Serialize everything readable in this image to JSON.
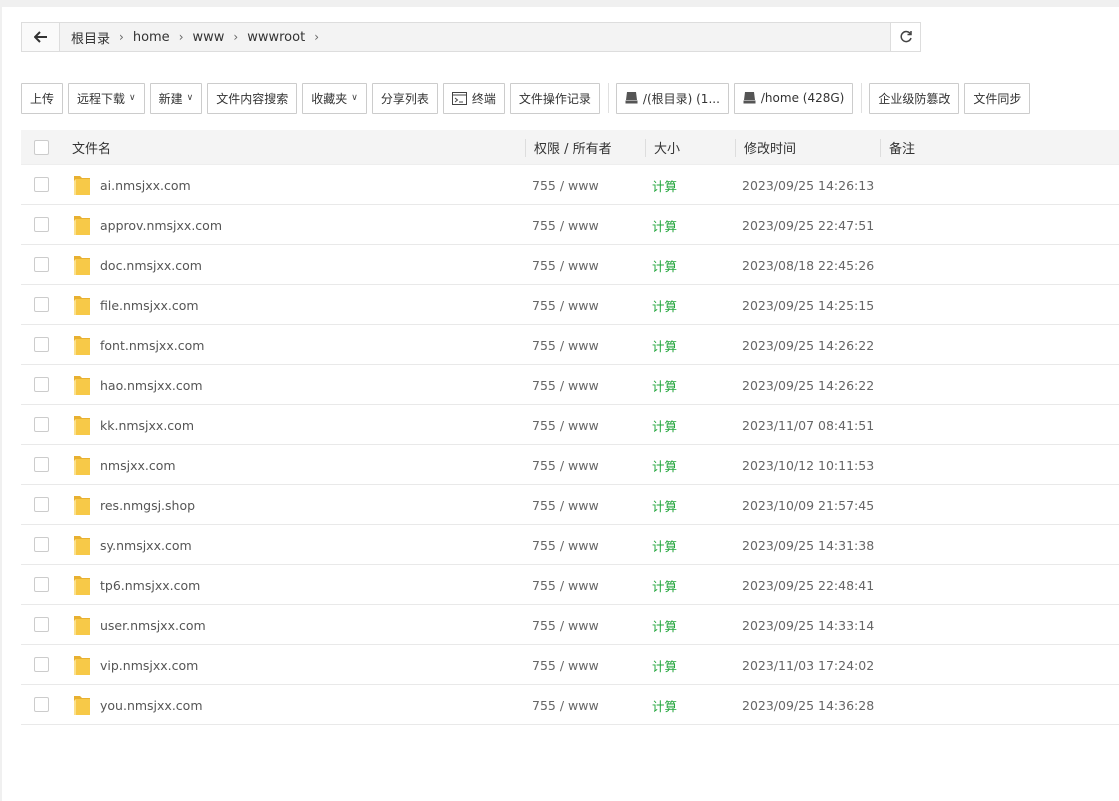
{
  "address": {
    "breadcrumbs": [
      "根目录",
      "home",
      "www",
      "wwwroot"
    ]
  },
  "toolbar": {
    "upload": "上传",
    "remote_download": "远程下载",
    "new": "新建",
    "content_search": "文件内容搜索",
    "favorites": "收藏夹",
    "share_list": "分享列表",
    "terminal": "终端",
    "operation_log": "文件操作记录",
    "disk_root": "/(根目录) (1...",
    "disk_home": "/home (428G)",
    "tamper_proof": "企业级防篡改",
    "file_sync": "文件同步"
  },
  "table": {
    "headers": {
      "name": "文件名",
      "perm": "权限 / 所有者",
      "size": "大小",
      "mtime": "修改时间",
      "note": "备注"
    },
    "rows": [
      {
        "name": "ai.nmsjxx.com",
        "perm": "755 / www",
        "size": "计算",
        "mtime": "2023/09/25 14:26:13"
      },
      {
        "name": "approv.nmsjxx.com",
        "perm": "755 / www",
        "size": "计算",
        "mtime": "2023/09/25 22:47:51"
      },
      {
        "name": "doc.nmsjxx.com",
        "perm": "755 / www",
        "size": "计算",
        "mtime": "2023/08/18 22:45:26"
      },
      {
        "name": "file.nmsjxx.com",
        "perm": "755 / www",
        "size": "计算",
        "mtime": "2023/09/25 14:25:15"
      },
      {
        "name": "font.nmsjxx.com",
        "perm": "755 / www",
        "size": "计算",
        "mtime": "2023/09/25 14:26:22"
      },
      {
        "name": "hao.nmsjxx.com",
        "perm": "755 / www",
        "size": "计算",
        "mtime": "2023/09/25 14:26:22"
      },
      {
        "name": "kk.nmsjxx.com",
        "perm": "755 / www",
        "size": "计算",
        "mtime": "2023/11/07 08:41:51"
      },
      {
        "name": "nmsjxx.com",
        "perm": "755 / www",
        "size": "计算",
        "mtime": "2023/10/12 10:11:53"
      },
      {
        "name": "res.nmgsj.shop",
        "perm": "755 / www",
        "size": "计算",
        "mtime": "2023/10/09 21:57:45"
      },
      {
        "name": "sy.nmsjxx.com",
        "perm": "755 / www",
        "size": "计算",
        "mtime": "2023/09/25 14:31:38"
      },
      {
        "name": "tp6.nmsjxx.com",
        "perm": "755 / www",
        "size": "计算",
        "mtime": "2023/09/25 22:48:41"
      },
      {
        "name": "user.nmsjxx.com",
        "perm": "755 / www",
        "size": "计算",
        "mtime": "2023/09/25 14:33:14"
      },
      {
        "name": "vip.nmsjxx.com",
        "perm": "755 / www",
        "size": "计算",
        "mtime": "2023/11/03 17:24:02"
      },
      {
        "name": "you.nmsjxx.com",
        "perm": "755 / www",
        "size": "计算",
        "mtime": "2023/09/25 14:36:28"
      }
    ]
  },
  "icons": {
    "back": "arrow-left-icon",
    "refresh": "refresh-icon",
    "terminal": "terminal-icon",
    "disk": "disk-icon",
    "folder": "folder-icon",
    "caret": "chevron-down-icon",
    "separator": "chevron-right-icon"
  },
  "colors": {
    "accent_green": "#20a53a",
    "folder_yellow": "#f7c948"
  }
}
